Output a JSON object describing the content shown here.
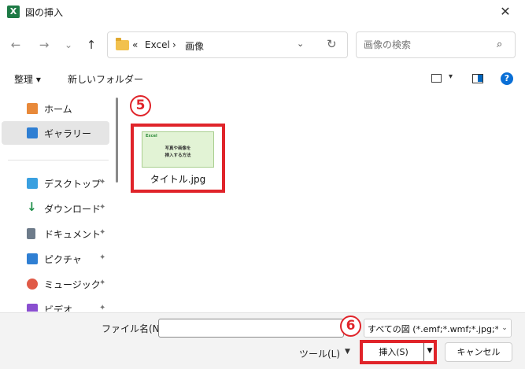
{
  "window": {
    "app_icon_letter": "X",
    "title": "図の挿入",
    "close_glyph": "✕"
  },
  "nav": {
    "back_glyph": "←",
    "forward_glyph": "→",
    "recent_glyph": "⌄",
    "up_glyph": "↑"
  },
  "address": {
    "overflow": "«",
    "crumbs": [
      "Excel",
      "画像"
    ],
    "separator": "›",
    "dropdown_glyph": "⌄",
    "refresh_glyph": "↻"
  },
  "search": {
    "placeholder": "画像の検索",
    "icon_glyph": "⌕"
  },
  "commandbar": {
    "organize": "整理 ▾",
    "new_folder": "新しいフォルダー",
    "view_dropdown": "▾",
    "help": "?"
  },
  "sidebar": {
    "items": [
      {
        "label": "ホーム",
        "icon": "home-icon",
        "color": "#e8893a"
      },
      {
        "label": "ギャラリー",
        "icon": "gallery-icon",
        "color": "#2f7fd3"
      },
      {
        "label": "デスクトップ",
        "icon": "desktop-icon",
        "color": "#3aa0e0"
      },
      {
        "label": "ダウンロード",
        "icon": "download-icon",
        "color": "#1f8f4a"
      },
      {
        "label": "ドキュメント",
        "icon": "documents-icon",
        "color": "#6d7b8a"
      },
      {
        "label": "ピクチャ",
        "icon": "pictures-icon",
        "color": "#2f7fd3"
      },
      {
        "label": "ミュージック",
        "icon": "music-icon",
        "color": "#e05a47"
      },
      {
        "label": "ビデオ",
        "icon": "videos-icon",
        "color": "#8a4fd0"
      }
    ],
    "pin_glyph": "📌"
  },
  "files": {
    "step_marker": "5",
    "items": [
      {
        "name": "タイトル.jpg",
        "thumb_tag": "Excel",
        "thumb_lines": [
          "写真や画像を",
          "挿入する方法"
        ]
      }
    ]
  },
  "footer": {
    "file_name_label": "ファイル名(N):",
    "file_name_value": "",
    "filter_text": "すべての図 (*.emf;*.wmf;*.jpg;*.j",
    "filter_dropdown": "⌄",
    "step_marker": "6",
    "tools_label": "ツール(L)",
    "tools_dropdown": "▼",
    "insert_label": "挿入(S)",
    "insert_dropdown": "▼",
    "cancel_label": "キャンセル"
  }
}
